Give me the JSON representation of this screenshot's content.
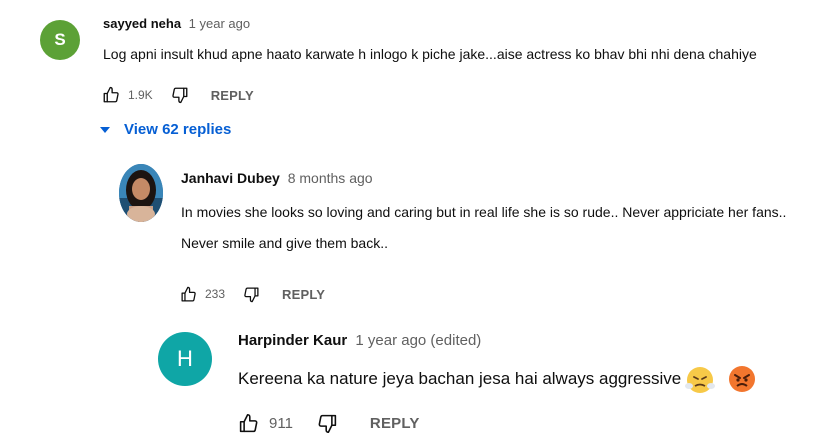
{
  "comments": [
    {
      "avatar_letter": "S",
      "avatar_color": "#5ca136",
      "author": "sayyed neha",
      "time": "1 year ago",
      "text": "Log apni insult khud apne haato karwate h inlogo k piche jake...aise actress ko bhav bhi nhi dena chahiye",
      "likes": "1.9K",
      "reply_label": "REPLY",
      "view_replies": "View 62 replies"
    },
    {
      "author": "Janhavi Dubey",
      "time": "8 months ago",
      "text_line1": "In movies she looks so loving and caring but in real life she is so rude.. Never appriciate her fans..",
      "text_line2": "Never smile and give them back..",
      "likes": "233",
      "reply_label": "REPLY"
    },
    {
      "avatar_letter": "H",
      "avatar_color": "#0fa6a6",
      "author": "Harpinder Kaur",
      "time": "1 year ago (edited)",
      "text": "Kereena ka nature jeya bachan jesa hai always aggressive",
      "likes": "911",
      "reply_label": "REPLY"
    }
  ],
  "colors": {
    "link_blue": "#065fd4",
    "secondary_text": "#606060"
  },
  "icons": [
    "thumb-up-icon",
    "thumb-down-icon",
    "caret-down-icon",
    "steaming-face-emoji",
    "angry-face-emoji"
  ]
}
